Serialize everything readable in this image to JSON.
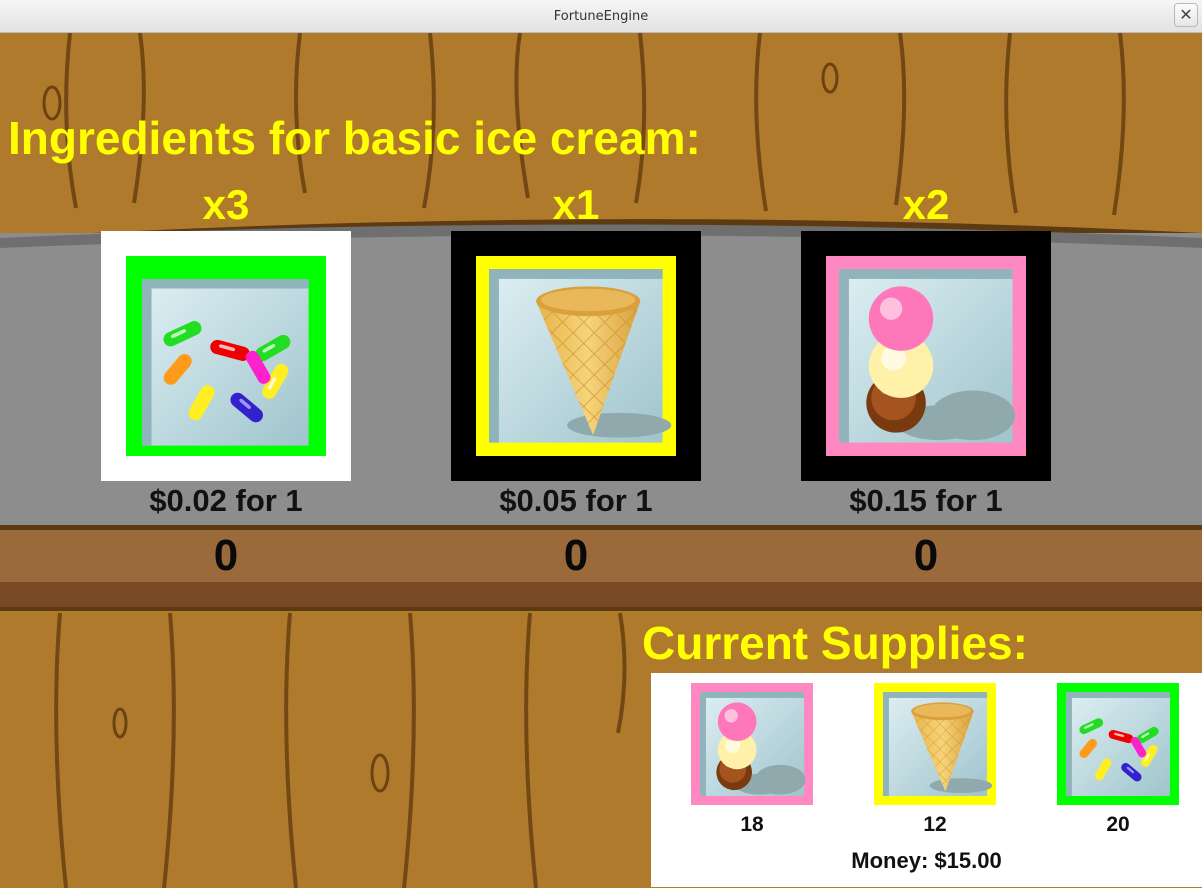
{
  "window": {
    "title": "FortuneEngine",
    "close_glyph": "✕"
  },
  "heading": "Ingredients for basic ice cream:",
  "ingredients": [
    {
      "name": "sprinkles",
      "multiplier": "x3",
      "price": "$0.02 for 1",
      "quantity": "0",
      "frame_color": "#00ff00",
      "selected": true
    },
    {
      "name": "cone",
      "multiplier": "x1",
      "price": "$0.05 for 1",
      "quantity": "0",
      "frame_color": "#ffff00",
      "selected": false
    },
    {
      "name": "scoops",
      "multiplier": "x2",
      "price": "$0.15 for 1",
      "quantity": "0",
      "frame_color": "#ff88c0",
      "selected": false
    }
  ],
  "supplies": {
    "heading": "Current Supplies:",
    "items": [
      {
        "name": "scoops",
        "count": "18",
        "frame_color": "#ff88c0"
      },
      {
        "name": "cone",
        "count": "12",
        "frame_color": "#ffff00"
      },
      {
        "name": "sprinkles",
        "count": "20",
        "frame_color": "#00ff00"
      }
    ],
    "money": "Money: $15.00"
  },
  "colors": {
    "heading": "#ffff00",
    "wood": "#b07a2c",
    "counter": "#8a8a8a",
    "shelf": "#8e5a2a"
  }
}
